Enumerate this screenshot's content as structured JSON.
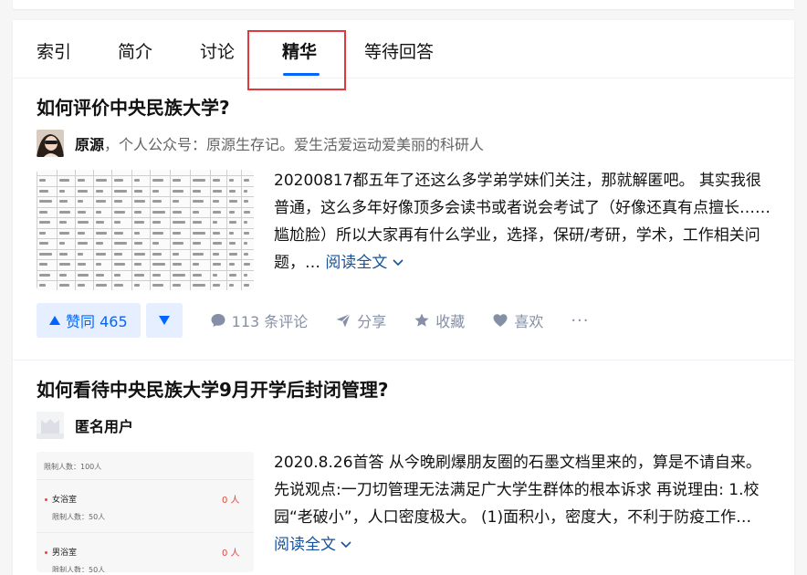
{
  "tabs": [
    {
      "label": "索引"
    },
    {
      "label": "简介"
    },
    {
      "label": "讨论"
    },
    {
      "label": "精华",
      "active": true
    },
    {
      "label": "等待回答"
    }
  ],
  "items": [
    {
      "title": "如何评价中央民族大学?",
      "author": "原源",
      "bio": "，个人公众号：原源生存记。爱生活爱运动爱美丽的科研人",
      "excerpt": "20200817都五年了还这么多学弟学妹们关注，那就解匿吧。 其实我很普通，这么多年好像顶多会读书或者说会考试了（好像还真有点擅长……尴尬脸）所以大家再有什么学业，选择，保研/考研，学术，工作相关问题，…",
      "read_more": "阅读全文",
      "vote_label": "赞同 465",
      "comments": "113 条评论",
      "share": "分享",
      "favorite": "收藏",
      "like": "喜欢",
      "more": "···"
    },
    {
      "title": "如何看待中央民族大学9月开学后封闭管理?",
      "author": "匿名用户",
      "bio": "",
      "excerpt": "2020.8.26首答 从今晚刷爆朋友圈的石墨文档里来的，算是不请自来。 先说观点:一刀切管理无法满足广大学生群体的根本诉求 再说理由: 1.校园“老破小”，人口密度极大。 (1)面积小，密度大，不利于防疫工作…",
      "read_more": "阅读全文",
      "thumb": {
        "limit_top": "限制人数：100人",
        "row1_name": "女浴室",
        "row1_val": "0 人",
        "row1_limit": "限制人数：50人",
        "row2_name": "男浴室",
        "row2_val": "0 人",
        "row2_limit": "限制人数：50人"
      }
    }
  ],
  "colors": {
    "accent": "#0066ff",
    "link": "#175199",
    "muted": "#8590a6",
    "highlight": "#e0383e"
  }
}
